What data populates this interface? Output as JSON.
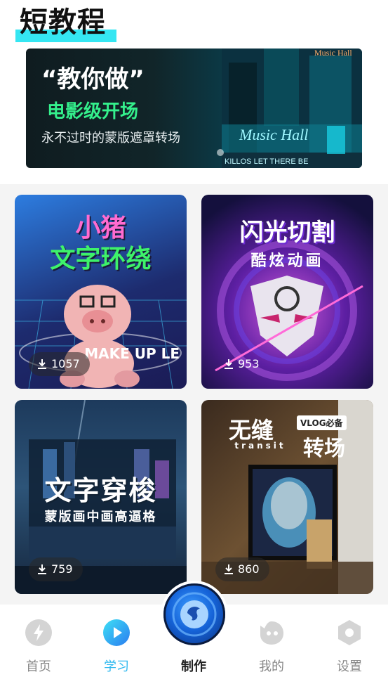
{
  "header": {
    "title": "短教程"
  },
  "banner": {
    "headline": "“教你做”",
    "highlight": "电影级开场",
    "subtitle": "永不过时的蒙版遮罩转场",
    "scene_text": [
      "Music Hall",
      "Music Hall",
      "KILLOS LET THERE BE"
    ]
  },
  "tutorials": [
    {
      "title_line1": "小猪",
      "title_line2": "文字环绕",
      "overlay_text": "MAKE UP LE",
      "downloads": "1057"
    },
    {
      "title_line1": "闪光切割",
      "title_line2": "酷炫动画",
      "downloads": "953"
    },
    {
      "title_line1": "文字穿梭",
      "title_line2": "蒙版画中画高逼格",
      "downloads": "759"
    },
    {
      "title_line1": "无缝",
      "title_line2": "转场",
      "tag": "VLOG必备",
      "overlay_text": "transit",
      "downloads": "860"
    }
  ],
  "nav": {
    "items": [
      {
        "label": "首页",
        "icon": "lightning-icon"
      },
      {
        "label": "学习",
        "icon": "play-icon",
        "active": true
      },
      {
        "label": "制作",
        "icon": "create-icon",
        "center": true
      },
      {
        "label": "我的",
        "icon": "profile-icon"
      },
      {
        "label": "设置",
        "icon": "settings-hexagon-icon"
      }
    ]
  },
  "colors": {
    "accent": "#2eb8ef",
    "title_highlight": "#35e6f2",
    "banner_green": "#34f08c"
  }
}
